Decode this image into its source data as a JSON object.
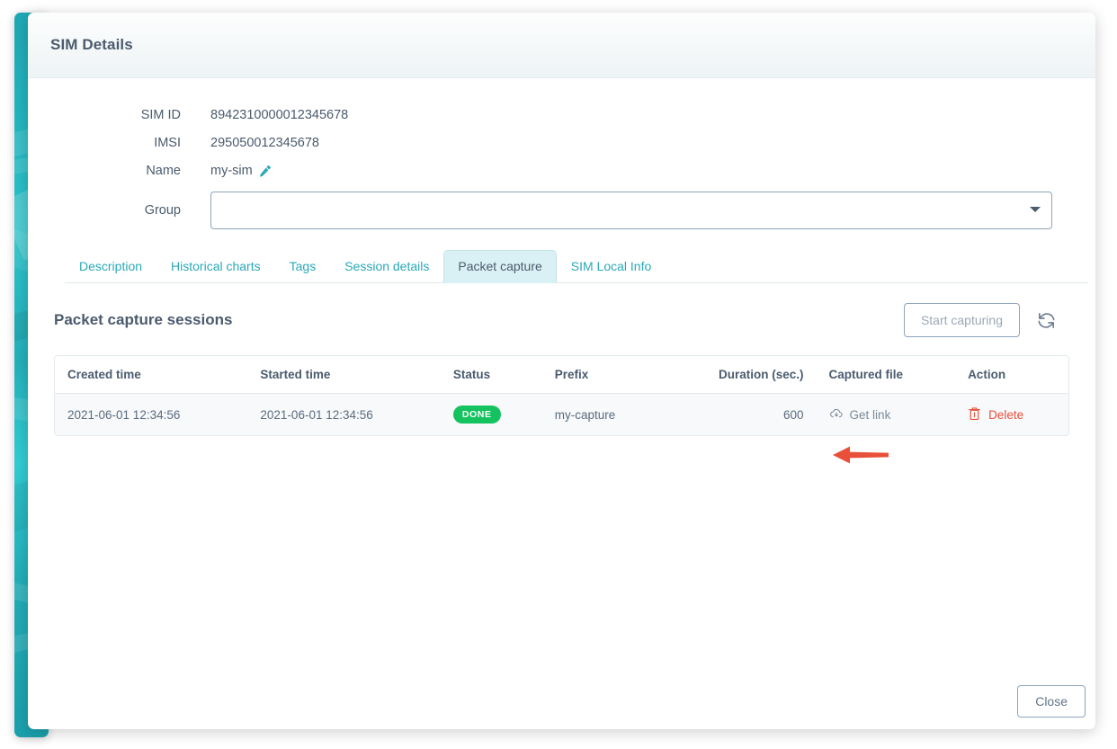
{
  "modal": {
    "title": "SIM Details",
    "close_label": "Close"
  },
  "details": {
    "sim_id": {
      "label": "SIM ID",
      "value": "8942310000012345678"
    },
    "imsi": {
      "label": "IMSI",
      "value": "295050012345678"
    },
    "name": {
      "label": "Name",
      "value": "my-sim",
      "edit_icon": "pencil-icon"
    },
    "group": {
      "label": "Group",
      "value": "",
      "caret_icon": "chevron-down-icon"
    }
  },
  "tabs": [
    {
      "label": "Description",
      "active": false
    },
    {
      "label": "Historical charts",
      "active": false
    },
    {
      "label": "Tags",
      "active": false
    },
    {
      "label": "Session details",
      "active": false
    },
    {
      "label": "Packet capture",
      "active": true
    },
    {
      "label": "SIM Local Info",
      "active": false
    }
  ],
  "section": {
    "title": "Packet capture sessions",
    "start_button": "Start capturing",
    "refresh_icon": "refresh-icon"
  },
  "table": {
    "columns": [
      "Created time",
      "Started time",
      "Status",
      "Prefix",
      "Duration (sec.)",
      "Captured file",
      "Action"
    ],
    "rows": [
      {
        "created_time": "2021-06-01 12:34:56",
        "started_time": "2021-06-01 12:34:56",
        "status": "DONE",
        "prefix": "my-capture",
        "duration": "600",
        "captured_file": "Get link",
        "captured_file_icon": "cloud-download-icon",
        "action": "Delete",
        "action_icon": "trash-icon"
      }
    ]
  },
  "annotation": {
    "arrow": "left-pointing-arrow",
    "color": "#e8503a"
  },
  "colors": {
    "accent_teal": "#2aa9b8",
    "status_green": "#14c25f",
    "danger_red": "#e8503a",
    "text_dark": "#4b5b6e"
  }
}
